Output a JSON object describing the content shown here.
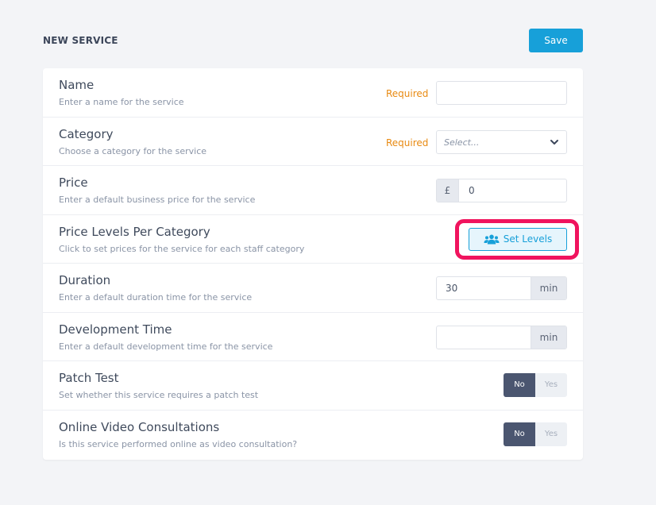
{
  "header": {
    "title": "NEW SERVICE",
    "save_label": "Save"
  },
  "colors": {
    "accent": "#17a0d9",
    "required": "#e88a12",
    "highlight": "#f0145e",
    "toggle_active": "#4b5670"
  },
  "fields": {
    "name": {
      "title": "Name",
      "description": "Enter a name for the service",
      "required_label": "Required",
      "value": ""
    },
    "category": {
      "title": "Category",
      "description": "Choose a category for the service",
      "required_label": "Required",
      "placeholder": "Select..."
    },
    "price": {
      "title": "Price",
      "description": "Enter a default business price for the service",
      "currency": "£",
      "value": "0"
    },
    "price_levels": {
      "title": "Price Levels Per Category",
      "description": "Click to set prices for the service for each staff category",
      "button_label": "Set Levels",
      "icon": "users-icon"
    },
    "duration": {
      "title": "Duration",
      "description": "Enter a default duration time for the service",
      "value": "30",
      "unit": "min"
    },
    "development": {
      "title": "Development Time",
      "description": "Enter a default development time for the service",
      "value": "",
      "unit": "min"
    },
    "patch_test": {
      "title": "Patch Test",
      "description": "Set whether this service requires a patch test",
      "no_label": "No",
      "yes_label": "Yes",
      "selected": "No"
    },
    "online_video": {
      "title": "Online Video Consultations",
      "description": "Is this service performed online as video consultation?",
      "no_label": "No",
      "yes_label": "Yes",
      "selected": "No"
    }
  }
}
